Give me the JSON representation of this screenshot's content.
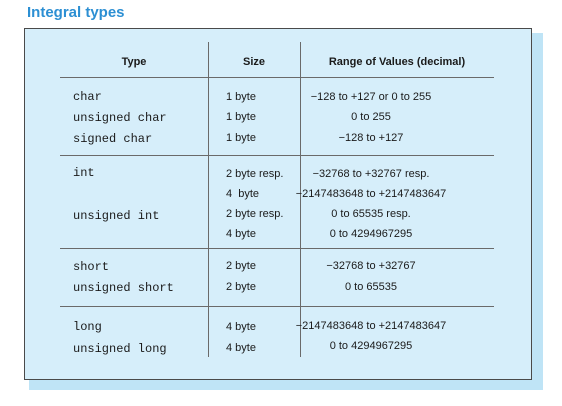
{
  "title": "Integral types",
  "columns": {
    "type": "Type",
    "size": "Size",
    "range": "Range of Values (decimal)"
  },
  "groups": [
    {
      "types": [
        "char",
        "unsigned char",
        "signed char"
      ],
      "sizes": [
        "1 byte",
        "1 byte",
        "1 byte"
      ],
      "ranges": [
        "−128 to +127 or 0 to 255",
        "0 to 255",
        "−128 to +127"
      ]
    },
    {
      "types": [
        "int",
        "unsigned int"
      ],
      "sizes": [
        "2 byte resp.",
        "4  byte",
        "2 byte resp.",
        "4 byte"
      ],
      "ranges": [
        "−32768 to +32767 resp.",
        "−2147483648 to +2147483647",
        "0 to 65535 resp.",
        "0 to 4294967295"
      ]
    },
    {
      "types": [
        "short",
        "unsigned short"
      ],
      "sizes": [
        "2 byte",
        "2 byte"
      ],
      "ranges": [
        "−32768 to +32767",
        "0 to 65535"
      ]
    },
    {
      "types": [
        "long",
        "unsigned long"
      ],
      "sizes": [
        "4 byte",
        "4 byte"
      ],
      "ranges": [
        "−2147483648 to +2147483647",
        "0 to 4294967295"
      ]
    }
  ]
}
